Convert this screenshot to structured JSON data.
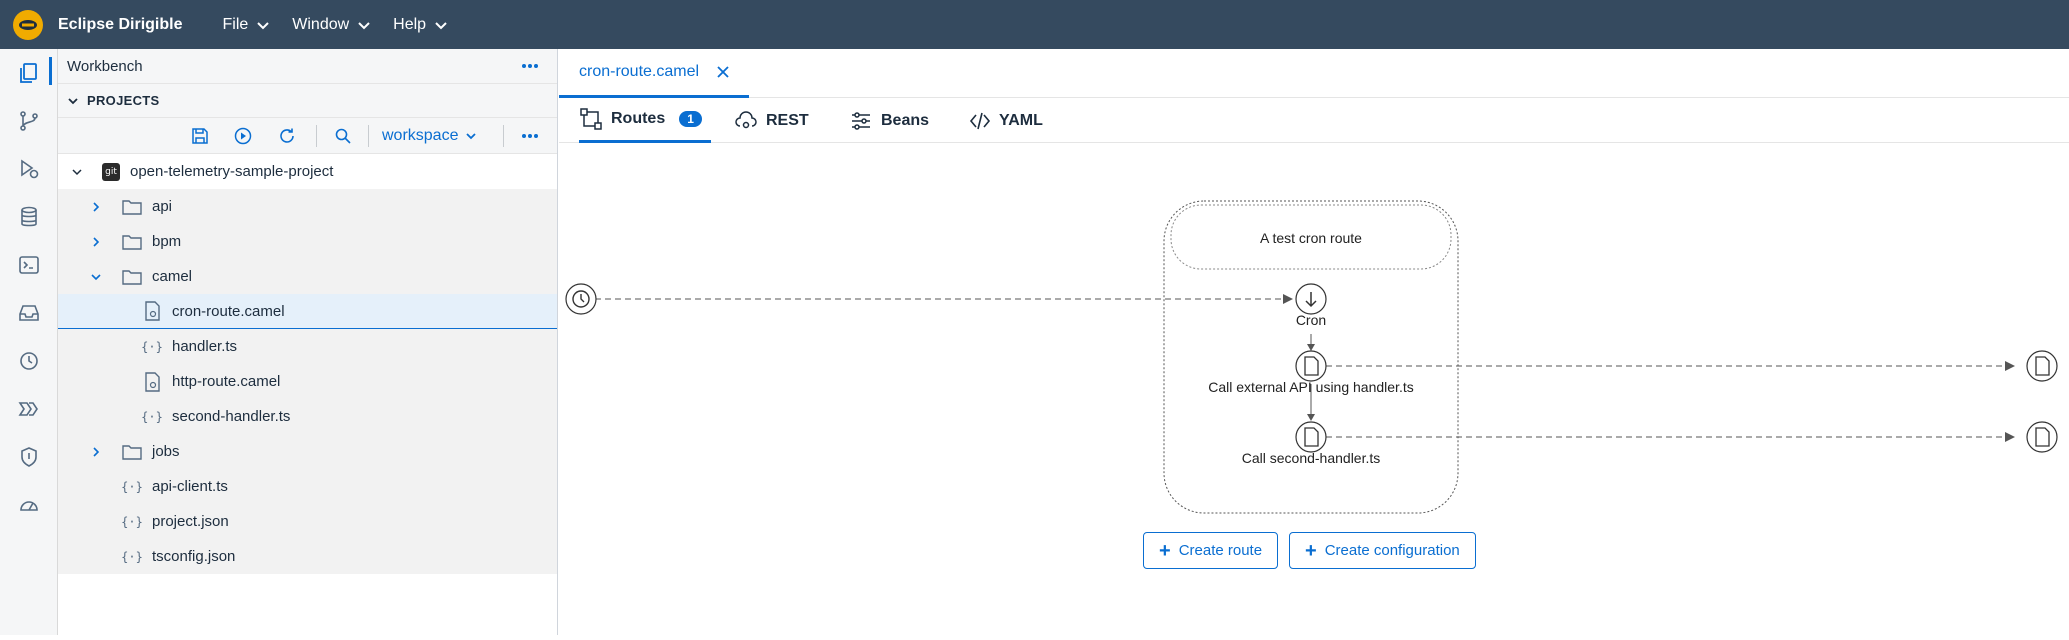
{
  "app": {
    "title": "Eclipse Dirigible"
  },
  "menu": [
    "File",
    "Window",
    "Help"
  ],
  "activity": [
    "projects-icon",
    "git-icon",
    "debug-icon",
    "database-icon",
    "terminal-icon",
    "inbox-icon",
    "history-icon",
    "pipeline-icon",
    "security-icon",
    "dashboard-icon"
  ],
  "sidebar": {
    "title": "Workbench",
    "section": "PROJECTS",
    "workspace": "workspace",
    "project": "open-telemetry-sample-project",
    "project_badge": "git",
    "items": [
      {
        "label": "api",
        "type": "folder",
        "level": 1,
        "expanded": false
      },
      {
        "label": "bpm",
        "type": "folder",
        "level": 1,
        "expanded": false
      },
      {
        "label": "camel",
        "type": "folder",
        "level": 1,
        "expanded": true
      },
      {
        "label": "cron-route.camel",
        "type": "camel",
        "level": 2
      },
      {
        "label": "handler.ts",
        "type": "code",
        "level": 2
      },
      {
        "label": "http-route.camel",
        "type": "camel",
        "level": 2
      },
      {
        "label": "second-handler.ts",
        "type": "code",
        "level": 2
      },
      {
        "label": "jobs",
        "type": "folder",
        "level": 1,
        "expanded": false
      },
      {
        "label": "api-client.ts",
        "type": "code",
        "level": 1
      },
      {
        "label": "project.json",
        "type": "code",
        "level": 1
      },
      {
        "label": "tsconfig.json",
        "type": "code",
        "level": 1
      }
    ]
  },
  "editor": {
    "tab": "cron-route.camel",
    "subtabs": [
      {
        "label": "Routes",
        "badge": "1"
      },
      {
        "label": "REST"
      },
      {
        "label": "Beans"
      },
      {
        "label": "YAML"
      }
    ],
    "route": {
      "description": "A test cron route",
      "steps": [
        "Cron",
        "Call external API using handler.ts",
        "Call second-handler.ts"
      ]
    },
    "buttons": {
      "create_route": "Create route",
      "create_configuration": "Create configuration"
    }
  },
  "colors": {
    "header": "#354a5f",
    "accent": "#0a6ed1",
    "logo": "#f0ab00"
  }
}
